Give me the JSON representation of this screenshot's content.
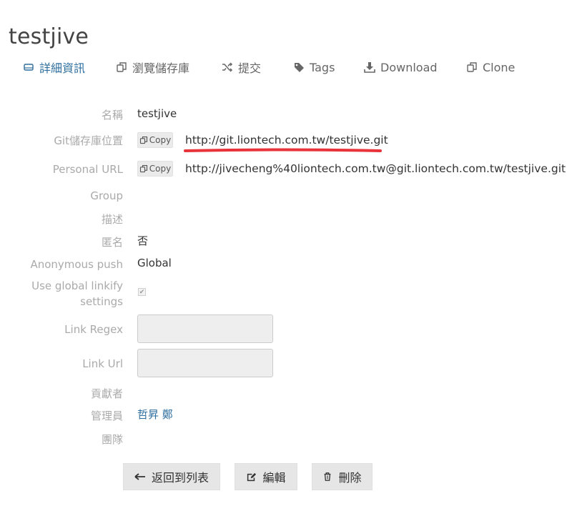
{
  "page": {
    "title": "testjive"
  },
  "tabs": [
    {
      "label": "詳細資訊",
      "icon": "hdd-icon",
      "active": true
    },
    {
      "label": "瀏覽儲存庫",
      "icon": "copy-icon"
    },
    {
      "label": "提交",
      "icon": "random-icon"
    },
    {
      "label": "Tags",
      "icon": "tag-icon"
    },
    {
      "label": "Download",
      "icon": "download-icon"
    },
    {
      "label": "Clone",
      "icon": "copy-icon"
    }
  ],
  "details": {
    "name_label": "名稱",
    "name_value": "testjive",
    "git_label": "Git儲存庫位置",
    "git_copy": "Copy",
    "git_url": "http://git.liontech.com.tw/testjive.git",
    "personal_label": "Personal URL",
    "personal_copy": "Copy",
    "personal_url": "http://jivecheng%40liontech.com.tw@git.liontech.com.tw/testjive.git",
    "group_label": "Group",
    "desc_label": "描述",
    "anon_label": "匿名",
    "anon_value": "否",
    "anon_push_label": "Anonymous push",
    "anon_push_value": "Global",
    "linkify_label_1": "Use global linkify",
    "linkify_label_2": "settings",
    "linkify_checked": true,
    "regex_label": "Link Regex",
    "regex_value": "",
    "url_label": "Link Url",
    "url_value": "",
    "contrib_label": "貢獻者",
    "admin_label": "管理員",
    "admin_value": "哲昇 鄭",
    "team_label": "團隊"
  },
  "actions": {
    "back_label": "返回到列表",
    "edit_label": "編輯",
    "delete_label": "刪除"
  },
  "colors": {
    "accent": "#2f6f9f",
    "annotation": "#e8333a"
  }
}
